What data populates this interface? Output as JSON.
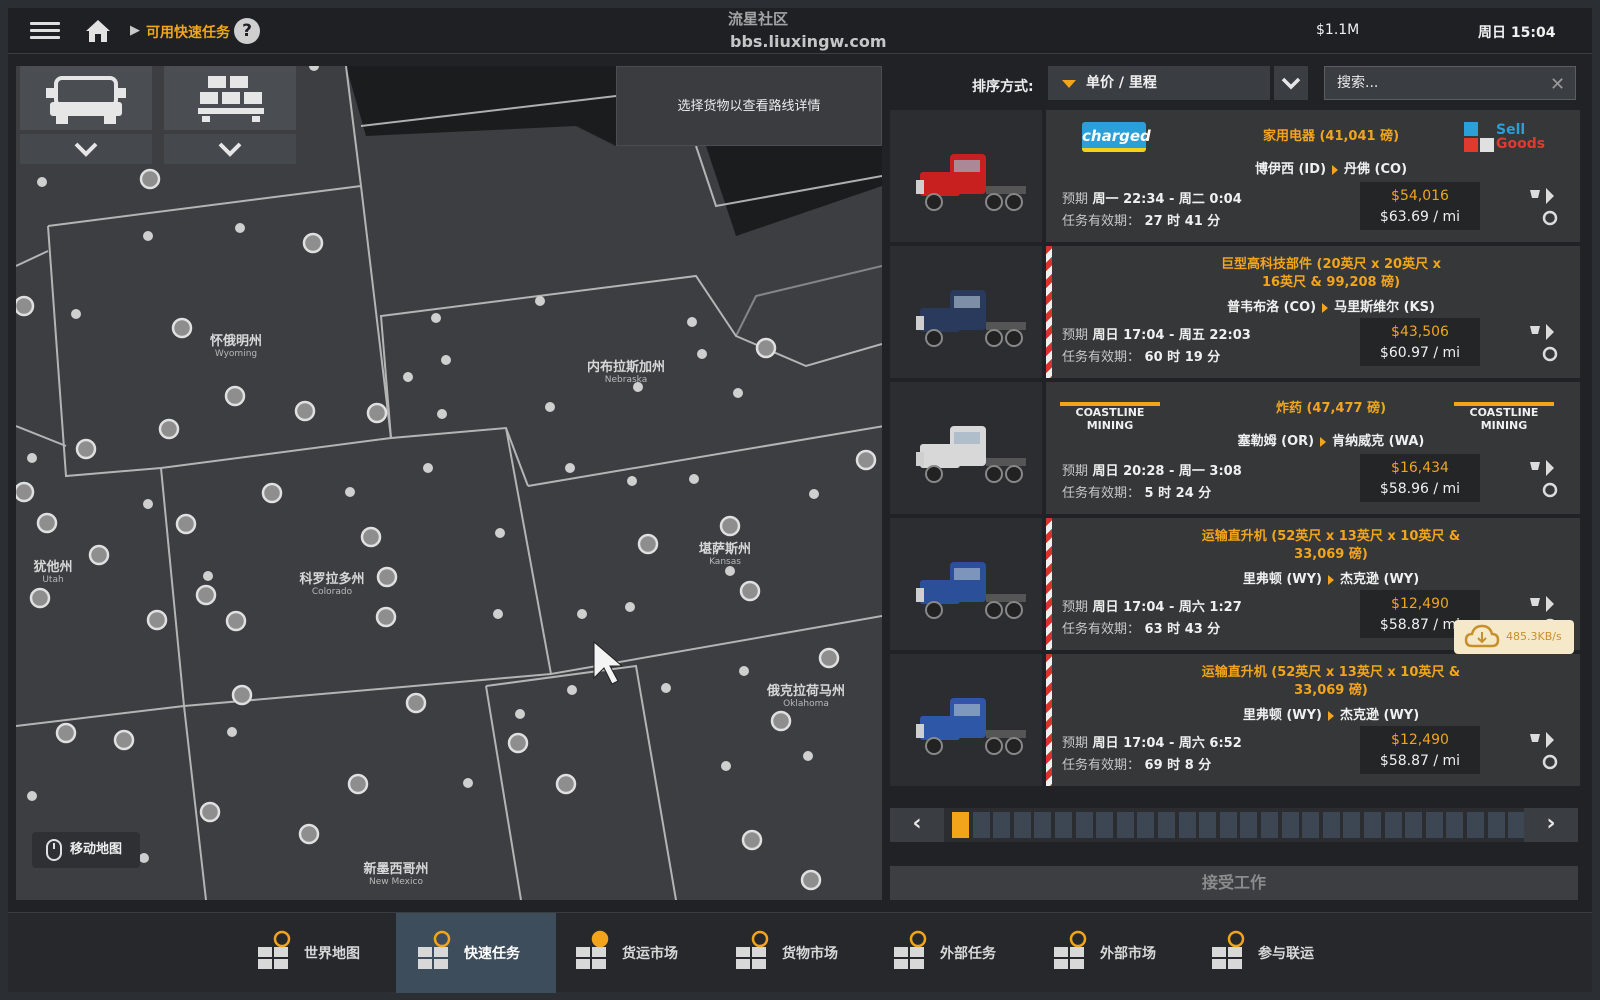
{
  "topbar": {
    "breadcrumb": "可用快速任务",
    "help": "?",
    "watermark_1": "流星社区",
    "watermark_2": "bbs.liuxingw.com",
    "money": "$1.1M",
    "time": "周日 15:04"
  },
  "map": {
    "info": "选择货物以查看路线详情",
    "move_map": "移动地图",
    "states": [
      {
        "name": "怀俄明州",
        "en": "Wyoming"
      },
      {
        "name": "内布拉斯加州",
        "en": "Nebraska"
      },
      {
        "name": "犹他州",
        "en": "Utah"
      },
      {
        "name": "科罗拉多州",
        "en": "Colorado"
      },
      {
        "name": "堪萨斯州",
        "en": "Kansas"
      },
      {
        "name": "俄克拉荷马州",
        "en": "Oklahoma"
      },
      {
        "name": "新墨西哥州",
        "en": "New Mexico"
      }
    ]
  },
  "sort": {
    "label": "排序方式:",
    "value": "单价 / 里程",
    "search_placeholder": "搜索..."
  },
  "jobs": [
    {
      "cargo": "家用电器 (41,041 磅)",
      "cargo_2": "",
      "from": "博伊西 (ID)",
      "to": "丹佛 (CO)",
      "eta_label": "预期",
      "eta": "周一 22:34 - 周二 0:04",
      "valid_label": "任务有效期：",
      "valid": "27 时 41 分",
      "total": "$54,016",
      "rate": "$63.69 / mi",
      "logo_left": "charged",
      "logo_right_1": "Sell",
      "logo_right_2": "Goods",
      "truck_color": "#c8201f",
      "stripe": false
    },
    {
      "cargo": "巨型高科技部件 (20英尺 x 20英尺 x",
      "cargo_2": "16英尺 & 99,208 磅)",
      "from": "普韦布洛 (CO)",
      "to": "马里斯维尔 (KS)",
      "eta_label": "预期",
      "eta": "周日 17:04 - 周五 22:03",
      "valid_label": "任务有效期：",
      "valid": "60 时 19 分",
      "total": "$43,506",
      "rate": "$60.97 / mi",
      "logo_left": "",
      "logo_right_1": "",
      "logo_right_2": "",
      "truck_color": "#2a3a5c",
      "stripe": true
    },
    {
      "cargo": "炸药 (47,477 磅)",
      "cargo_2": "",
      "from": "塞勒姆 (OR)",
      "to": "肯纳威克 (WA)",
      "eta_label": "预期",
      "eta": "周日 20:28 - 周一 3:08",
      "valid_label": "任务有效期：",
      "valid": "5 时 24 分",
      "total": "$16,434",
      "rate": "$58.96 / mi",
      "logo_left": "COASTLINE MINING",
      "logo_right_1": "COASTLINE MINING",
      "logo_right_2": "",
      "truck_color": "#d8d8d8",
      "stripe": false
    },
    {
      "cargo": "运输直升机 (52英尺 x 13英尺 x 10英尺 &",
      "cargo_2": "33,069 磅)",
      "from": "里弗顿 (WY)",
      "to": "杰克逊 (WY)",
      "eta_label": "预期",
      "eta": "周日 17:04 - 周六 1:27",
      "valid_label": "任务有效期：",
      "valid": "63 时 43 分",
      "total": "$12,490",
      "rate": "$58.87 / mi",
      "logo_left": "",
      "logo_right_1": "",
      "logo_right_2": "",
      "truck_color": "#2c4f9a",
      "stripe": true
    },
    {
      "cargo": "运输直升机 (52英尺 x 13英尺 x 10英尺 &",
      "cargo_2": "33,069 磅)",
      "from": "里弗顿 (WY)",
      "to": "杰克逊 (WY)",
      "eta_label": "预期",
      "eta": "周日 17:04 - 周六 6:52",
      "valid_label": "任务有效期：",
      "valid": "69 时 8 分",
      "total": "$12,490",
      "rate": "$58.87 / mi",
      "logo_left": "",
      "logo_right_1": "",
      "logo_right_2": "",
      "truck_color": "#2f57a8",
      "stripe": true
    }
  ],
  "pager": {
    "prev": "‹",
    "next": "›",
    "pages": 28,
    "current": 1
  },
  "accept": "接受工作",
  "tooltip": {
    "speed": "485.3KB/s",
    "badge": "1"
  },
  "nav": [
    {
      "label": "世界地图",
      "icon": "world-map-icon"
    },
    {
      "label": "快速任务",
      "icon": "quick-job-icon"
    },
    {
      "label": "货运市场",
      "icon": "freight-market-icon"
    },
    {
      "label": "货物市场",
      "icon": "cargo-market-icon"
    },
    {
      "label": "外部任务",
      "icon": "external-jobs-icon"
    },
    {
      "label": "外部市场",
      "icon": "external-market-icon"
    },
    {
      "label": "参与联运",
      "icon": "convoy-icon"
    }
  ],
  "colors": {
    "accent": "#f2a51a",
    "active_nav": "#3d4d5b",
    "panel": "#353739"
  }
}
